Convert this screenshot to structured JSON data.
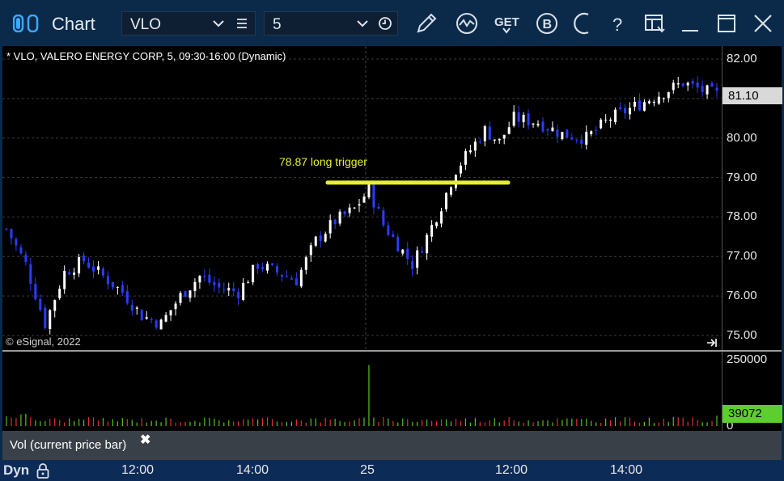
{
  "window": {
    "title": "Chart",
    "symbol": "VLO",
    "interval": "5",
    "toolbar_icons": [
      "draw-pencil-icon",
      "study-wave-icon",
      "get-data-icon",
      "b-circle-icon",
      "refresh-arc-icon",
      "help-icon",
      "layout-icon",
      "minimize-icon",
      "maximize-icon",
      "close-icon"
    ],
    "toolbar_get_label": "GET",
    "toolbar_b_label": "B",
    "toolbar_help_label": "?"
  },
  "chart": {
    "header": "* VLO, VALERO ENERGY CORP, 5, 09:30-16:00 (Dynamic)",
    "copyright": "© eSignal, 2022",
    "last_price_badge": "81.10",
    "annotation_text": "78.87 long trigger",
    "study_label": "Vol (current price bar)",
    "study_close": "✖",
    "dyn_label": "Dyn",
    "volume_last_badge": "39072",
    "volume_zero_label": "0"
  },
  "colors": {
    "up_candle": "#ffffff",
    "down_candle": "#2a3cff",
    "trigger_line": "#e8f02a",
    "volume_up": "#52c41a",
    "volume_down": "#e03030",
    "title_bar": "#0b2a4a",
    "time_axis_bar": "#0d2b57"
  },
  "chart_data": [
    {
      "type": "candlestick",
      "title": "* VLO, VALERO ENERGY CORP, 5, 09:30-16:00 (Dynamic)",
      "y_axis": {
        "ylim": [
          74.7,
          82.3
        ],
        "ticks": [
          "82.00",
          "81.00",
          "80.00",
          "79.00",
          "78.00",
          "77.00",
          "76.00",
          "75.00"
        ]
      },
      "x_axis": {
        "ticks": [
          "12:00",
          "14:00",
          "25",
          "12:00",
          "14:00"
        ]
      },
      "last_price": 81.1,
      "annotation": {
        "label": "78.87 long trigger",
        "price": 78.87
      },
      "close_path": [
        {
          "bar": 0,
          "price": 77.7
        },
        {
          "bar": 4,
          "price": 76.8
        },
        {
          "bar": 8,
          "price": 75.3
        },
        {
          "bar": 12,
          "price": 76.6
        },
        {
          "bar": 16,
          "price": 76.9
        },
        {
          "bar": 20,
          "price": 76.5
        },
        {
          "bar": 24,
          "price": 76.1
        },
        {
          "bar": 28,
          "price": 75.5
        },
        {
          "bar": 32,
          "price": 75.3
        },
        {
          "bar": 36,
          "price": 76.0
        },
        {
          "bar": 40,
          "price": 76.5
        },
        {
          "bar": 44,
          "price": 76.2
        },
        {
          "bar": 48,
          "price": 76.1
        },
        {
          "bar": 52,
          "price": 76.8
        },
        {
          "bar": 56,
          "price": 76.6
        },
        {
          "bar": 60,
          "price": 76.4
        },
        {
          "bar": 64,
          "price": 77.4
        },
        {
          "bar": 68,
          "price": 77.9
        },
        {
          "bar": 72,
          "price": 78.2
        },
        {
          "bar": 75,
          "price": 78.7
        },
        {
          "bar": 78,
          "price": 77.8
        },
        {
          "bar": 81,
          "price": 77.3
        },
        {
          "bar": 84,
          "price": 76.8
        },
        {
          "bar": 87,
          "price": 77.5
        },
        {
          "bar": 90,
          "price": 78.3
        },
        {
          "bar": 93,
          "price": 79.2
        },
        {
          "bar": 96,
          "price": 79.7
        },
        {
          "bar": 99,
          "price": 80.2
        },
        {
          "bar": 102,
          "price": 79.9
        },
        {
          "bar": 105,
          "price": 80.5
        },
        {
          "bar": 110,
          "price": 80.4
        },
        {
          "bar": 115,
          "price": 80.1
        },
        {
          "bar": 120,
          "price": 80.0
        },
        {
          "bar": 125,
          "price": 80.5
        },
        {
          "bar": 130,
          "price": 80.8
        },
        {
          "bar": 135,
          "price": 81.1
        },
        {
          "bar": 140,
          "price": 81.4
        },
        {
          "bar": 144,
          "price": 81.2
        },
        {
          "bar": 147,
          "price": 81.1
        }
      ],
      "bar_count": 148
    },
    {
      "type": "bar",
      "title": "Vol (current price bar)",
      "y_axis": {
        "ticks": [
          "250000",
          "0"
        ],
        "ylim": [
          0,
          250000
        ]
      },
      "last_value": 39072,
      "spike": {
        "bar": 75,
        "value": 230000
      }
    }
  ]
}
